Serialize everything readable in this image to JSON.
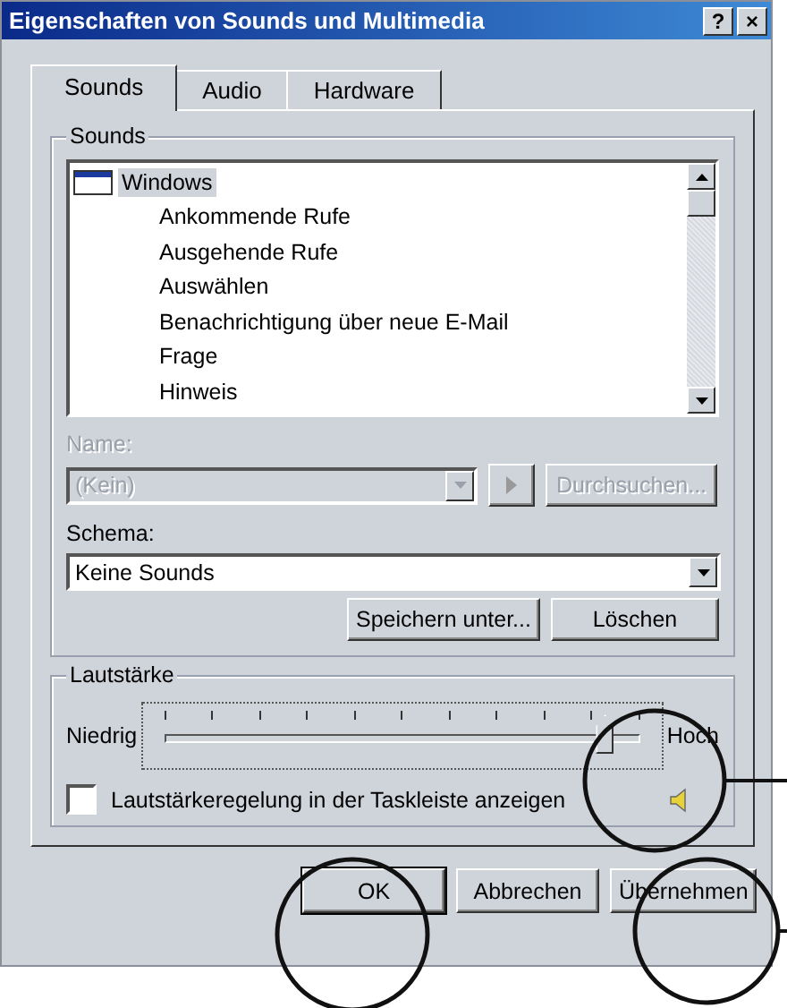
{
  "window": {
    "title": "Eigenschaften von Sounds und Multimedia",
    "help_button": "?",
    "close_button": "×"
  },
  "tabs": [
    {
      "label": "Sounds",
      "selected": true
    },
    {
      "label": "Audio",
      "selected": false
    },
    {
      "label": "Hardware",
      "selected": false
    }
  ],
  "sounds_group": {
    "title": "Sounds",
    "events": [
      {
        "label": "Windows",
        "selected": true,
        "kind": "group"
      },
      {
        "label": "Ankommende Rufe",
        "selected": false,
        "kind": "event"
      },
      {
        "label": "Ausgehende Rufe",
        "selected": false,
        "kind": "event"
      },
      {
        "label": "Auswählen",
        "selected": false,
        "kind": "event"
      },
      {
        "label": "Benachrichtigung über neue E-Mail",
        "selected": false,
        "kind": "event"
      },
      {
        "label": "Frage",
        "selected": false,
        "kind": "event"
      },
      {
        "label": "Hinweis",
        "selected": false,
        "kind": "event"
      }
    ],
    "name": {
      "label": "Name:",
      "value": "(Kein)",
      "disabled": true
    },
    "play_button": {
      "disabled": true
    },
    "browse_button": {
      "label": "Durchsuchen...",
      "disabled": true
    },
    "scheme": {
      "label": "Schema:",
      "value": "Keine Sounds"
    },
    "save_button": "Speichern unter...",
    "delete_button": "Löschen"
  },
  "volume_group": {
    "title": "Lautstärke",
    "low_label": "Niedrig",
    "high_label": "Hoch",
    "level": 0.93,
    "taskbar_checkbox": {
      "label": "Lautstärkeregelung in der Taskleiste anzeigen",
      "checked": false
    }
  },
  "buttons": [
    {
      "label": "OK",
      "default": true
    },
    {
      "label": "Abbrechen",
      "default": false
    },
    {
      "label": "Übernehmen",
      "default": false
    }
  ]
}
